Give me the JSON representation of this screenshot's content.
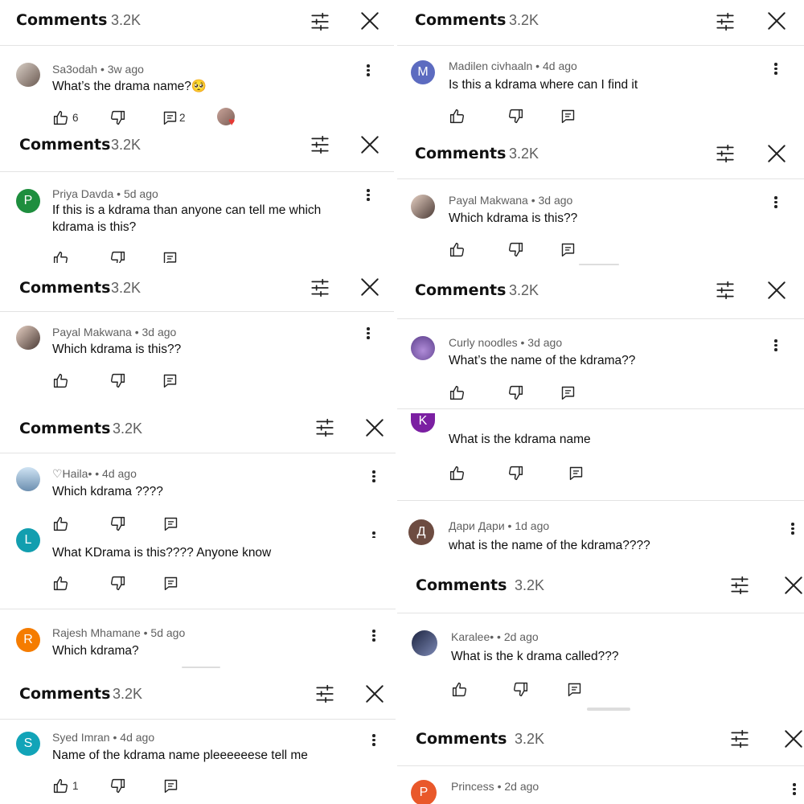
{
  "header": {
    "title": "Comments",
    "count": "3.2K"
  },
  "icons": {
    "filter": "sliders-icon",
    "close": "close-icon",
    "more": "more-vert-icon",
    "like": "thumb-up-icon",
    "dislike": "thumb-down-icon",
    "reply": "reply-icon"
  },
  "colors": {
    "text": "#0f0f0f",
    "meta": "#606060",
    "divider": "#e3e3e3"
  },
  "panels": {
    "l1": {
      "author": "Sa3odah",
      "age": "3w ago",
      "text": "What’s the drama name?🥺",
      "likes": "6",
      "replies": "2"
    },
    "l2": {
      "avatar": "P",
      "avatar_color": "#1e8e3e",
      "author": "Priya Davda",
      "age": "5d ago",
      "text": "If this is a kdrama than anyone can tell me which kdrama is this?"
    },
    "l3": {
      "author": "Payal Makwana",
      "age": "3d ago",
      "text": "Which kdrama is this??"
    },
    "l4": {
      "c1": {
        "author": "♡Haila•",
        "age": "4d ago",
        "text": "Which kdrama ????"
      },
      "c2": {
        "avatar": "L",
        "avatar_color": "#129eaf",
        "text": "What KDrama is this???? Anyone know"
      },
      "c3": {
        "avatar": "R",
        "avatar_color": "#f57c00",
        "author": "Rajesh Mhamane",
        "age": "5d ago",
        "text": "Which kdrama?"
      }
    },
    "l5": {
      "avatar": "S",
      "avatar_color": "#12a4b8",
      "author": "Syed Imran",
      "age": "4d ago",
      "text": "Name of the kdrama name pleeeeeese tell me",
      "likes": "1"
    },
    "r1": {
      "avatar": "M",
      "avatar_color": "#5c6bc0",
      "author": "Madilen civhaaln",
      "age": "4d ago",
      "text": "Is this a kdrama where can I find it"
    },
    "r2": {
      "author": "Payal Makwana",
      "age": "3d ago",
      "text": "Which kdrama is this??"
    },
    "r3": {
      "c1": {
        "author": "Curly noodles",
        "age": "3d ago",
        "text": "What’s the name of the kdrama??"
      },
      "c2": {
        "avatar": "K",
        "avatar_color": "#7b1fa2",
        "text": "What is the kdrama name"
      },
      "c3": {
        "avatar": "Д",
        "avatar_color": "#6d4c41",
        "author": "Дари Дари",
        "age": "1d ago",
        "text": "what is the name of the kdrama????"
      }
    },
    "r4": {
      "author": "Karalee•",
      "age": "2d ago",
      "text": "What is the k drama called???"
    },
    "r5": {
      "avatar": "P",
      "avatar_color": "#e9582a",
      "author": "Princess",
      "age": "2d ago"
    }
  }
}
